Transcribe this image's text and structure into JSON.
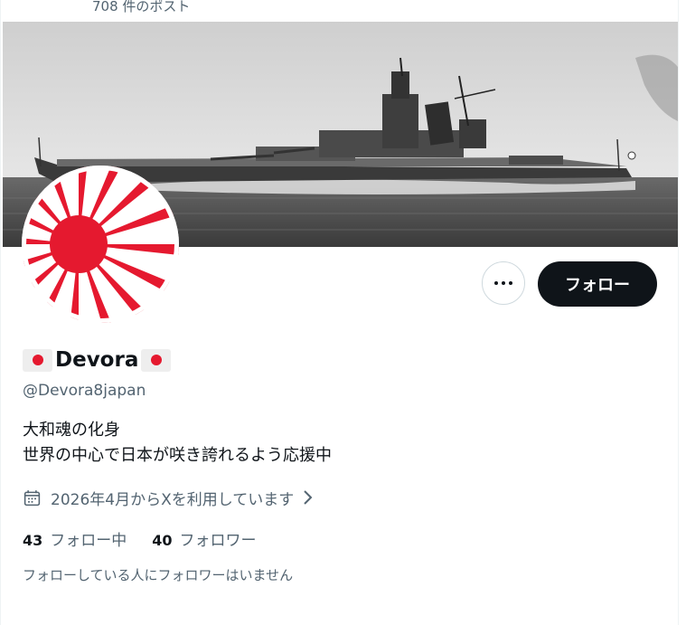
{
  "header": {
    "post_count": "708 件のポスト"
  },
  "profile": {
    "display_name": "Devora",
    "name_emoji": "flag-japan-emoji",
    "handle": "@Devora8japan",
    "bio_line1": "大和魂の化身",
    "bio_line2": "世界の中心で日本が咲き誇れるよう応援中",
    "joined": "2026年4月からXを利用しています",
    "following_count": "43",
    "following_label": "フォロー中",
    "followers_count": "40",
    "followers_label": "フォロワー",
    "mutual_note": "フォローしている人にフォロワーはいません"
  },
  "actions": {
    "follow_label": "フォロー",
    "more_icon": "more-dots-icon"
  },
  "colors": {
    "follow_button_bg": "#0f1419",
    "flag_red": "#e5192f",
    "secondary_text": "#536471"
  }
}
